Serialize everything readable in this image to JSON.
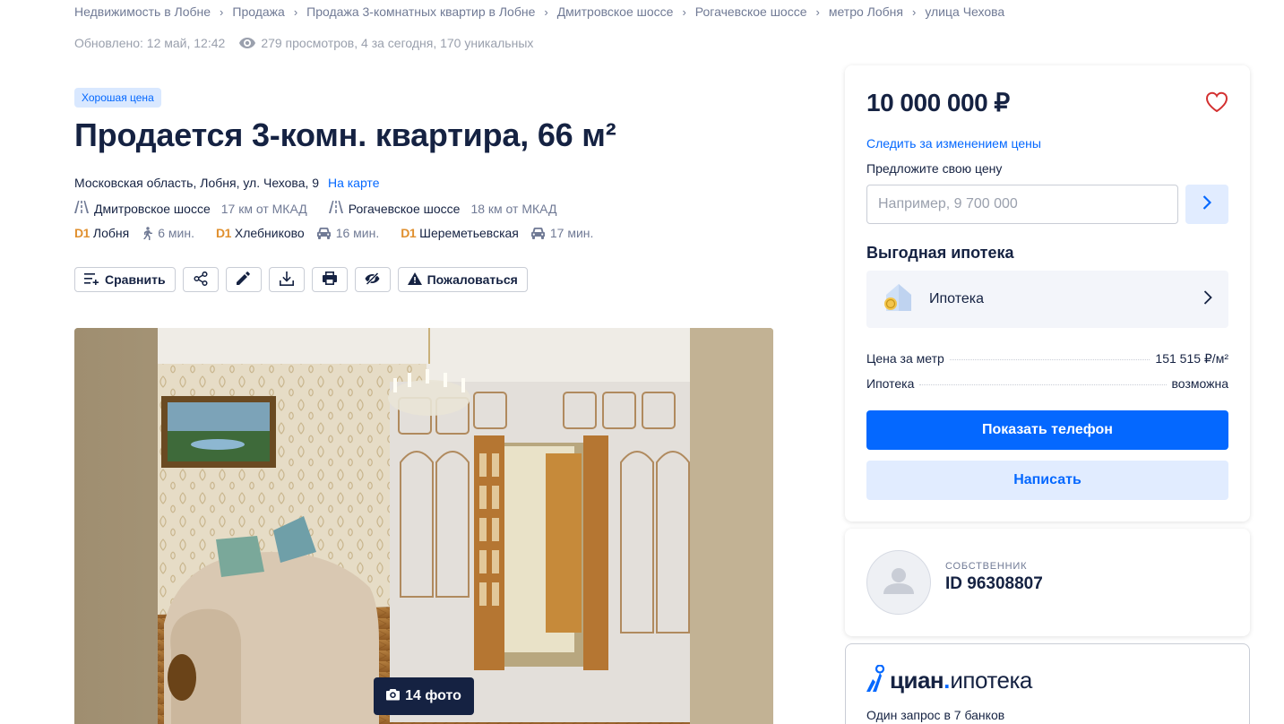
{
  "breadcrumbs": [
    "Недвижимость в Лобне",
    "Продажа",
    "Продажа 3-комнатных квартир в Лобне",
    "Дмитровское шоссе",
    "Рогачевское шоссе",
    "метро Лобня",
    "улица Чехова"
  ],
  "meta": {
    "updated": "Обновлено: 12 май, 12:42",
    "views": "279 просмотров, 4 за сегодня, 170 уникальных"
  },
  "badge": "Хорошая цена",
  "title": "Продается 3-комн. квартира, 66 м²",
  "address": {
    "text": "Московская область, Лобня, ул. Чехова, 9",
    "map_link": "На карте"
  },
  "highways": [
    {
      "name": "Дмитровское шоссе",
      "distance": "17 км от МКАД"
    },
    {
      "name": "Рогачевское шоссе",
      "distance": "18 км от МКАД"
    }
  ],
  "metros": [
    {
      "line": "D1",
      "station": "Лобня",
      "mode": "walk",
      "time": "6 мин."
    },
    {
      "line": "D1",
      "station": "Хлебниково",
      "mode": "car",
      "time": "16 мин."
    },
    {
      "line": "D1",
      "station": "Шереметьевская",
      "mode": "car",
      "time": "17 мин."
    }
  ],
  "toolbar": {
    "compare": "Сравнить",
    "complain": "Пожаловаться"
  },
  "gallery": {
    "photo_count": "14 фото"
  },
  "sidebar": {
    "price": "10 000 000 ₽",
    "follow_price": "Следить за изменением цены",
    "offer_label": "Предложите свою цену",
    "offer_placeholder": "Например, 9 700 000",
    "mortgage_title": "Выгодная ипотека",
    "mortgage_item": "Ипотека",
    "specs": [
      {
        "label": "Цена за метр",
        "value": "151 515 ₽/м²"
      },
      {
        "label": "Ипотека",
        "value": "возможна"
      }
    ],
    "show_phone": "Показать телефон",
    "write": "Написать"
  },
  "owner": {
    "role": "СОБСТВЕННИК",
    "id": "ID 96308807"
  },
  "cian": {
    "brand": "циан",
    "product": "ипотека",
    "subtitle": "Один запрос в 7 банков"
  },
  "colors": {
    "accent": "#0468ff",
    "text": "#152242",
    "secondary": "#707a95",
    "metro_d1": "#e0902f",
    "badge_bg": "#d9e8ff",
    "heart": "#d32f2f"
  }
}
